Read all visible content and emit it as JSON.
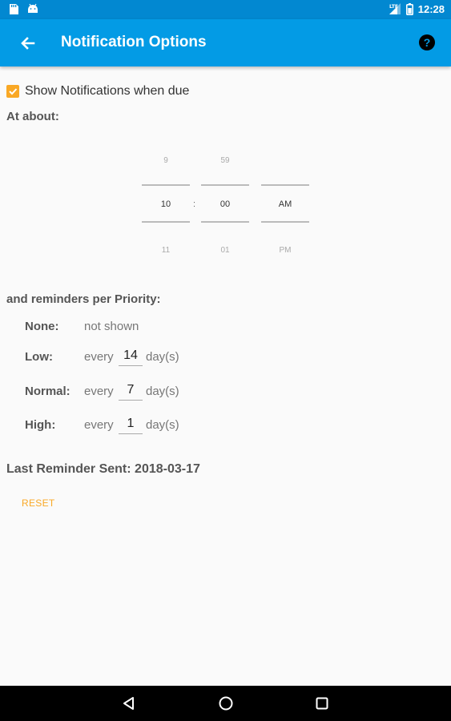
{
  "status_bar": {
    "time": "12:28",
    "left_icons": [
      "sd-card-icon",
      "android-icon"
    ],
    "right_icons": [
      "signal-icon",
      "battery-icon"
    ],
    "color": "#0288d1"
  },
  "app_bar": {
    "title": "Notification Options",
    "back_icon": "arrow-back-icon",
    "help_icon": "help-circle-icon",
    "color": "#039be5"
  },
  "show_notifications": {
    "label": "Show Notifications when due",
    "checked": true,
    "accent": "#f9a825"
  },
  "at_about_label": "At about:",
  "time_picker": {
    "hour": {
      "above": "9",
      "selected": "10",
      "below": "11"
    },
    "separator": ":",
    "minute": {
      "above": "59",
      "selected": "00",
      "below": "01"
    },
    "ampm": {
      "above": "",
      "selected": "AM",
      "below": "PM"
    }
  },
  "reminders_label": "and reminders per Priority:",
  "priorities": [
    {
      "label": "None:",
      "text": "not shown"
    },
    {
      "label": "Low:",
      "prefix": "every",
      "value": "14",
      "suffix": "day(s)"
    },
    {
      "label": "Normal:",
      "prefix": "every",
      "value": "7",
      "suffix": "day(s)"
    },
    {
      "label": "High:",
      "prefix": "every",
      "value": "1",
      "suffix": "day(s)"
    }
  ],
  "last_reminder": {
    "label": "Last Reminder Sent:",
    "date": "2018-03-17"
  },
  "reset_label": "RESET",
  "nav_bar": {
    "buttons": [
      "back-triangle-icon",
      "home-circle-icon",
      "recents-square-icon"
    ]
  }
}
